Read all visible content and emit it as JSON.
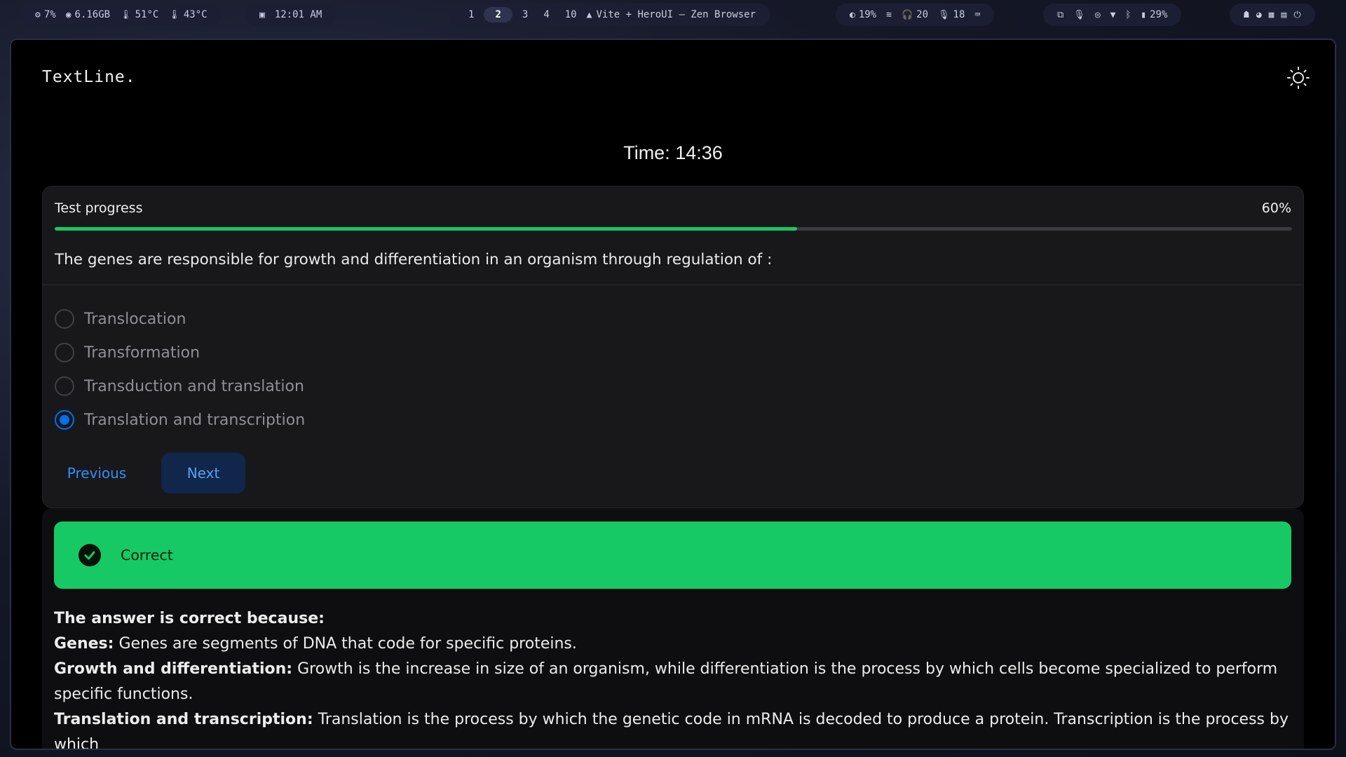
{
  "topbar": {
    "cpu": "7%",
    "mem": "6.16GB",
    "temp1": "51°C",
    "temp2": "43°C",
    "clock": "12:01 AM",
    "workspaces": [
      "1",
      "2",
      "3",
      "4",
      "10"
    ],
    "active_workspace": "2",
    "window_title": "Vite + HeroUI — Zen Browser",
    "brightness": "19%",
    "volume": "20",
    "mic": "18",
    "battery": "29%"
  },
  "app": {
    "logo": "TextLine.",
    "timer": "Time: 14:36",
    "progress": {
      "label": "Test progress",
      "value_text": "60%",
      "value": 0.6
    },
    "question": "The genes are responsible for growth and differentiation in an organism through regulation of :",
    "options": [
      {
        "label": "Translocation",
        "selected": false
      },
      {
        "label": "Transformation",
        "selected": false
      },
      {
        "label": "Transduction and translation",
        "selected": false
      },
      {
        "label": "Translation and transcription",
        "selected": true
      }
    ],
    "buttons": {
      "previous": "Previous",
      "next": "Next"
    },
    "result": {
      "label": "Correct"
    },
    "explanation": {
      "heading": "The answer is correct because:",
      "items": [
        {
          "term": "Genes:",
          "text": " Genes are segments of DNA that code for specific proteins."
        },
        {
          "term": "Growth and differentiation:",
          "text": " Growth is the increase in size of an organism, while differentiation is the process by which cells become specialized to perform specific functions."
        },
        {
          "term": "Translation and transcription:",
          "text": " Translation is the process by which the genetic code in mRNA is decoded to produce a protein. Transcription is the process by which"
        }
      ]
    }
  },
  "colors": {
    "accent": "#006fee",
    "success": "#17c964",
    "card": "#18181b"
  },
  "icons": {
    "theme_toggle": "sun-icon",
    "result": "check-circle-icon"
  }
}
